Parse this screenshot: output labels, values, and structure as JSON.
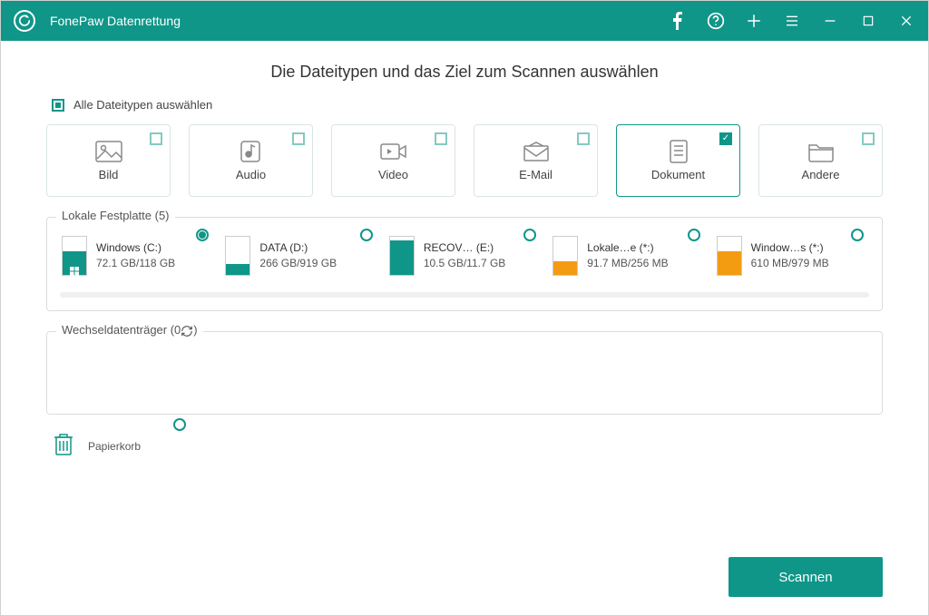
{
  "app": {
    "title": "FonePaw Datenrettung"
  },
  "main": {
    "heading": "Die Dateitypen und das Ziel zum Scannen auswählen",
    "select_all_label": "Alle Dateitypen auswählen",
    "types": {
      "image": "Bild",
      "audio": "Audio",
      "video": "Video",
      "email": "E-Mail",
      "document": "Dokument",
      "other": "Andere"
    },
    "local_drives_label": "Lokale Festplatte (5)",
    "drives": {
      "c": {
        "name": "Windows (C:)",
        "info": "72.1 GB/118 GB",
        "fill_pct": 61,
        "color": "teal",
        "selected": true,
        "system": true
      },
      "d": {
        "name": "DATA (D:)",
        "info": "266 GB/919 GB",
        "fill_pct": 29,
        "color": "teal",
        "selected": false
      },
      "e": {
        "name": "RECOV… (E:)",
        "info": "10.5 GB/11.7 GB",
        "fill_pct": 90,
        "color": "teal",
        "selected": false
      },
      "f": {
        "name": "Lokale…e (*:)",
        "info": "91.7 MB/256 MB",
        "fill_pct": 36,
        "color": "orange",
        "selected": false
      },
      "g": {
        "name": "Window…s (*:)",
        "info": "610 MB/979 MB",
        "fill_pct": 62,
        "color": "orange",
        "selected": false
      }
    },
    "removable_label": "Wechseldatenträger (0",
    "recycle_label": "Papierkorb",
    "scan_button": "Scannen"
  }
}
